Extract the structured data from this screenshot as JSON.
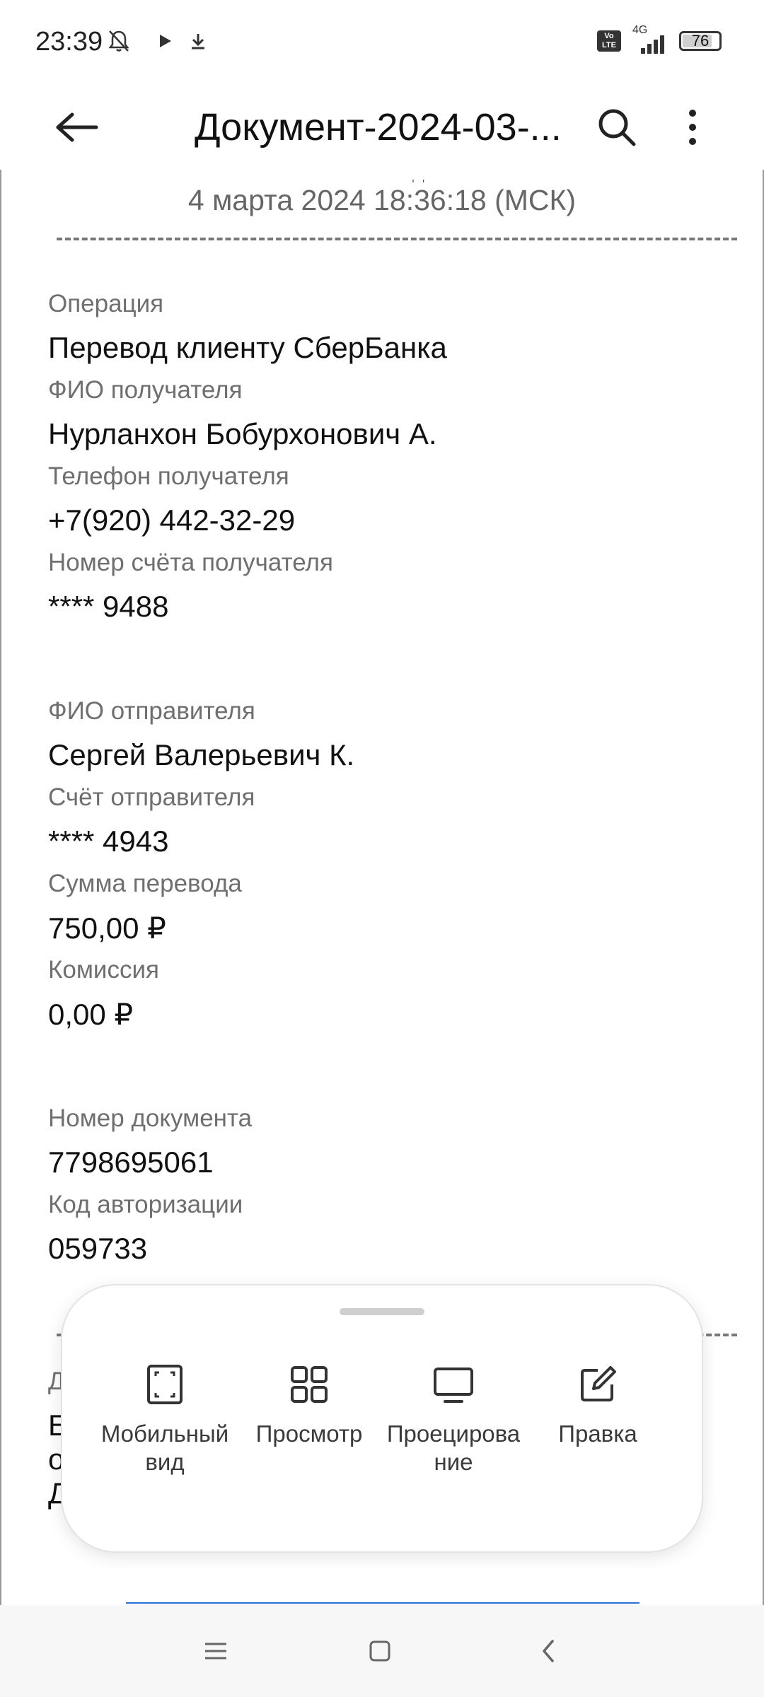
{
  "status_bar": {
    "time": "23:39",
    "icons": [
      "mute-bell-icon",
      "play-icon",
      "download-icon"
    ],
    "volte_label": "Vo LTE",
    "network_label": "4G",
    "battery_level": "76"
  },
  "app_bar": {
    "title": "Документ-2024-03-...",
    "icons": [
      "back-arrow-icon",
      "search-icon",
      "more-vert-icon"
    ]
  },
  "document": {
    "datetime": "4 марта 2024 18:36:18 (МСК)",
    "cut_marks": "ˌ       ˌ",
    "fields": [
      {
        "label": "Операция",
        "value": "Перевод клиенту СберБанка"
      },
      {
        "label": "ФИО получателя",
        "value": "Нурланхон Бобурхонович А."
      },
      {
        "label": "Телефон получателя",
        "value": "+7(920) 442-32-29"
      },
      {
        "label": "Номер счёта получателя",
        "value": "**** 9488"
      },
      {
        "label": "ФИО отправителя",
        "value": "Сергей Валерьевич К."
      },
      {
        "label": "Счёт отправителя",
        "value": "**** 4943"
      },
      {
        "label": "Сумма перевода",
        "value": "750,00 ₽"
      },
      {
        "label": "Комиссия",
        "value": "0,00 ₽"
      },
      {
        "label": "Номер документа",
        "value": "7798695061"
      },
      {
        "label": "Код авторизации",
        "value": "059733"
      }
    ],
    "partial_text": {
      "label": "Д",
      "line1": "Е",
      "line2": "о",
      "line3": "Д"
    }
  },
  "bottom_sheet": {
    "actions": [
      {
        "label": "Мобильный вид",
        "icon": "mobile-view-icon"
      },
      {
        "label": "Просмотр",
        "icon": "grid-view-icon"
      },
      {
        "label": "Проецирование",
        "icon": "monitor-icon"
      },
      {
        "label": "Правка",
        "icon": "edit-icon"
      }
    ]
  },
  "nav_bar": {
    "icons": [
      "menu-icon",
      "home-icon",
      "back-icon"
    ]
  }
}
